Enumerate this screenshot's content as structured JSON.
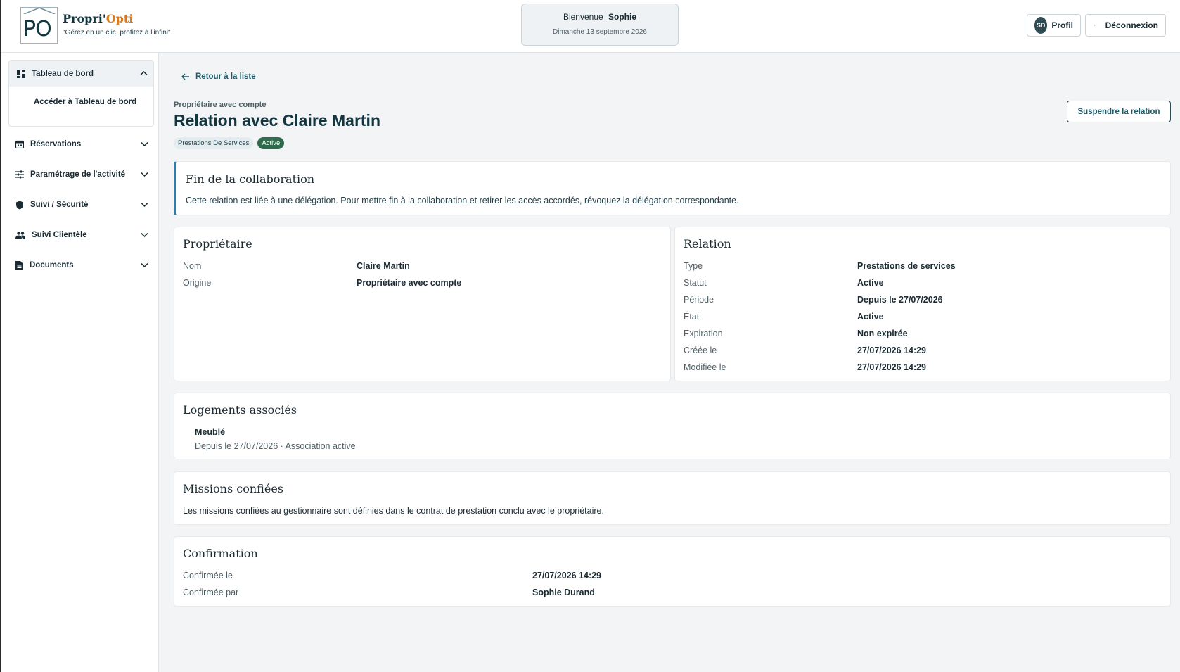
{
  "header": {
    "brand_main": "Propri'",
    "brand_accent": "Opti",
    "logo_letters": "PO",
    "slogan": "\"Gérez en un clic, profitez à l'infini\"",
    "welcome_label": "Bienvenue",
    "welcome_name": "Sophie",
    "date": "Dimanche 13 septembre 2026",
    "avatar_initials": "SD",
    "profile_label": "Profil",
    "logout_label": "Déconnexion"
  },
  "sidebar": {
    "dashboard": {
      "label": "Tableau de bord",
      "sub_link": "Accéder à Tableau de bord"
    },
    "items": [
      {
        "label": "Réservations",
        "icon": "calendar-icon"
      },
      {
        "label": "Paramétrage de l'activité",
        "icon": "sliders-icon"
      },
      {
        "label": "Suivi / Sécurité",
        "icon": "shield-icon"
      },
      {
        "label": "Suivi Clientèle",
        "icon": "people-icon"
      },
      {
        "label": "Documents",
        "icon": "document-icon"
      }
    ]
  },
  "main": {
    "back_label": "Retour à la liste",
    "kicker": "Propriétaire avec compte",
    "title": "Relation avec Claire Martin",
    "chip_type": "Prestations De Services",
    "chip_status": "Active",
    "suspend_label": "Suspendre la relation",
    "alert": {
      "title": "Fin de la collaboration",
      "text": "Cette relation est liée à une délégation. Pour mettre fin à la collaboration et retirer les accès accordés, révoquez la délégation correspondante."
    },
    "owner": {
      "title": "Propriétaire",
      "rows": [
        {
          "k": "Nom",
          "v": "Claire Martin"
        },
        {
          "k": "Origine",
          "v": "Propriétaire avec compte"
        }
      ]
    },
    "relation": {
      "title": "Relation",
      "rows": [
        {
          "k": "Type",
          "v": "Prestations de services"
        },
        {
          "k": "Statut",
          "v": "Active"
        },
        {
          "k": "Période",
          "v": "Depuis le 27/07/2026"
        },
        {
          "k": "État",
          "v": "Active"
        },
        {
          "k": "Expiration",
          "v": "Non expirée"
        },
        {
          "k": "Créée le",
          "v": "27/07/2026 14:29"
        },
        {
          "k": "Modifiée le",
          "v": "27/07/2026 14:29"
        }
      ]
    },
    "logements": {
      "title": "Logements associés",
      "name": "Meublé",
      "sub": "Depuis le 27/07/2026 · Association active"
    },
    "missions": {
      "title": "Missions confiées",
      "text": "Les missions confiées au gestionnaire sont définies dans le contrat de prestation conclu avec le propriétaire."
    },
    "confirmation": {
      "title": "Confirmation",
      "rows": [
        {
          "k": "Confirmée le",
          "v": "27/07/2026 14:29"
        },
        {
          "k": "Confirmée par",
          "v": "Sophie Durand"
        }
      ]
    }
  },
  "colors": {
    "accent": "#d97a1c",
    "primary": "#123640",
    "status_active": "#2f6b4c",
    "alert_border": "#2a7fb0"
  }
}
